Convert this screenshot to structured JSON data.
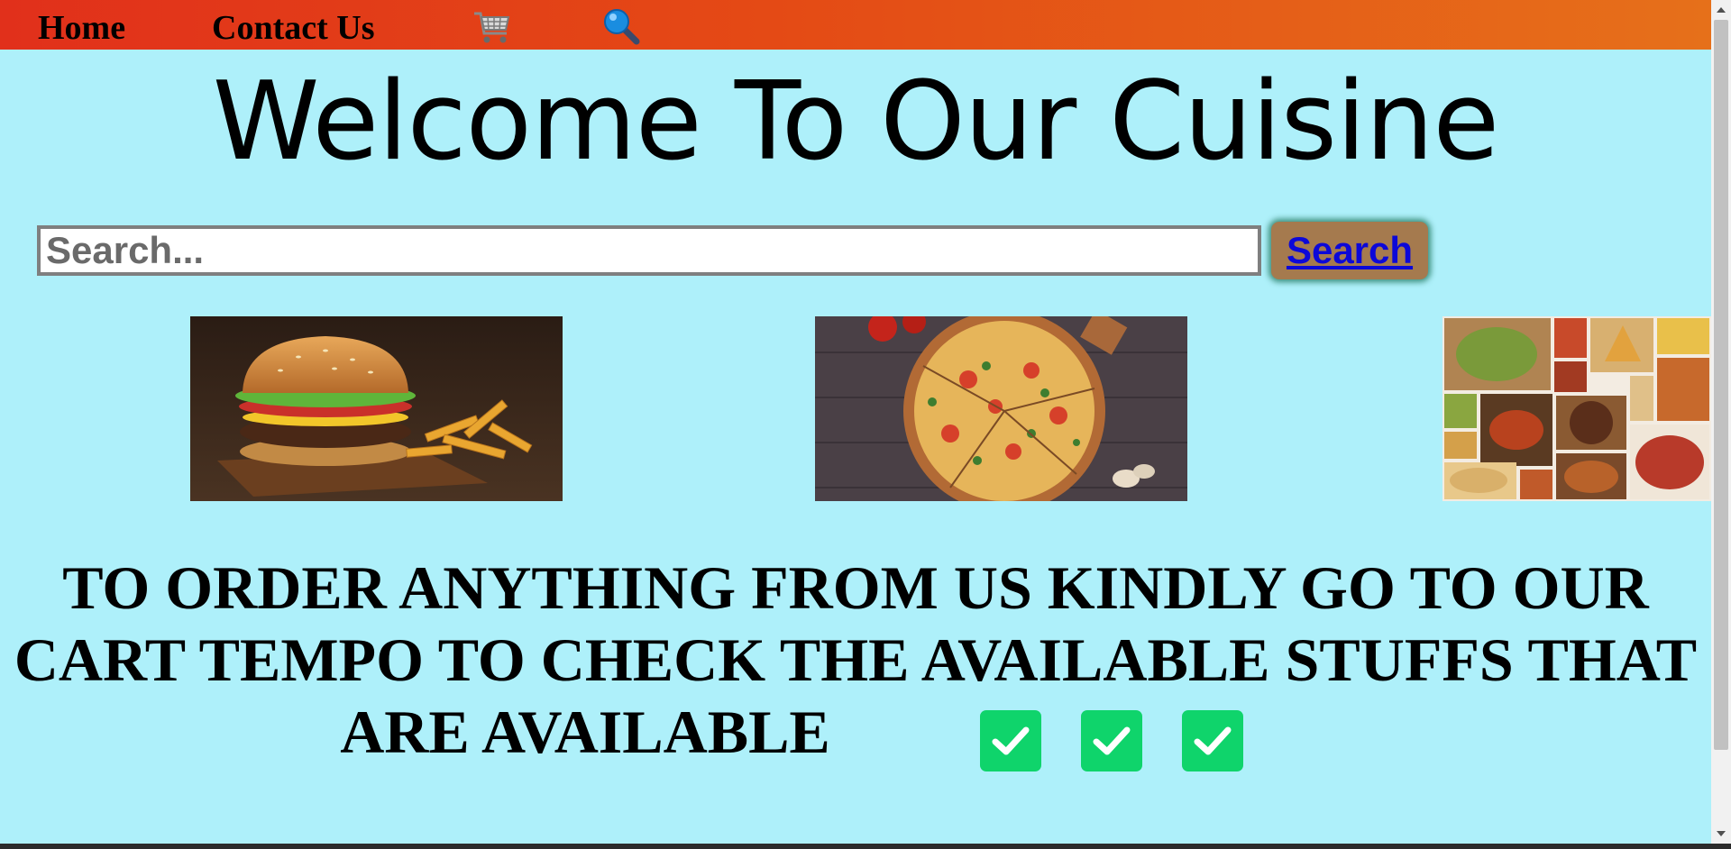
{
  "nav": {
    "home_label": "Home",
    "contact_label": "Contact Us",
    "cart_icon": "shopping-cart-icon",
    "search_icon": "magnifier-icon"
  },
  "heading": "Welcome To Our Cuisine",
  "search": {
    "placeholder": "Search...",
    "value": "",
    "button_label": "Search"
  },
  "gallery": [
    {
      "name": "burger-and-fries-image"
    },
    {
      "name": "pizza-image"
    },
    {
      "name": "indian-food-collage-image"
    }
  ],
  "message": {
    "line1": "TO ORDER ANYTHING FROM US KINDLY GO TO OUR",
    "line2": "CART TEMPO TO CHECK THE AVAILABLE STUFFS THAT",
    "line3": "ARE AVAILABLE"
  },
  "colors": {
    "page_background": "#aef0fa",
    "navbar_start": "#e1301b",
    "navbar_end": "#e6701a",
    "search_button": "#a57a4e",
    "link": "#0c08d8",
    "check": "#0fd46b"
  }
}
